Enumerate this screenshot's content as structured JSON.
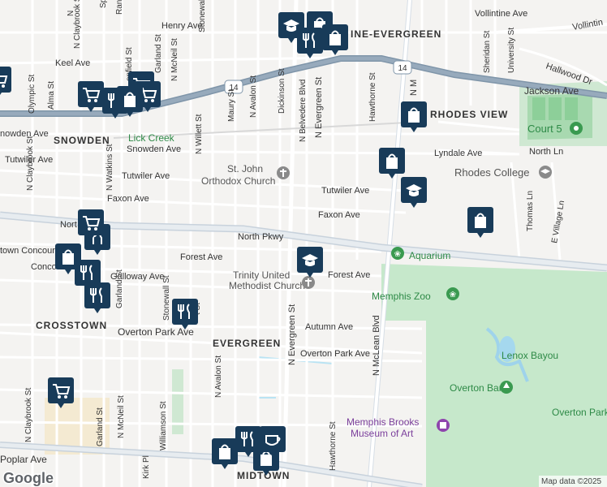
{
  "map": {
    "attribution": "Map data ©2025",
    "logo": "Google",
    "route_shield": "14",
    "areas": {
      "aquarium": "Aquarium",
      "memphis_zoo": "Memphis Zoo",
      "lenox_bayou": "Lenox Bayou",
      "overton_bark": "Overton Bark",
      "overton_park": "Overton Park",
      "brooks_museum": "Memphis Brooks Museum of Art",
      "brooks_line1": "Memphis Brooks",
      "brooks_line2": "Museum of Art",
      "court5": "Court 5",
      "rhodes_college": "Rhodes College",
      "st_john_line1": "St. John",
      "st_john_line2": "Orthodox Church",
      "trinity_line1": "Trinity United",
      "trinity_line2": "Methodist Church",
      "lick_creek": "Lick Creek"
    },
    "neighborhoods": {
      "snowden": "SNOWDEN",
      "crosstown": "CROSSTOWN",
      "evergreen": "EVERGREEN",
      "vollintine_evergreen": "INE-EVERGREEN",
      "rhodes_view": "RHODES VIEW",
      "midtown": "MIDTOWN",
      "town_concourse": "town Concours"
    },
    "streets": {
      "vollintine": "Vollintine Ave",
      "vollintin2": "Vollintin",
      "henry": "Henry Ave",
      "keel": "Keel Ave",
      "hallwood": "Hallwood Dr",
      "jackson": "Jackson Ave",
      "snowden_ave": "Snowden Ave",
      "snowden_ave2": "nowden Ave",
      "tutwiler": "Tutwiler Ave",
      "tutwiler2": "Tutwiler Ave",
      "tutwiler3": "Tutwiler Ave",
      "faxon": "Faxon Ave",
      "faxon2": "Faxon Ave",
      "lyndale": "Lyndale Ave",
      "north_ln": "North Ln",
      "north_pkwy": "North Pkwy",
      "north_pkwy_w": "Nort",
      "forest": "Forest Ave",
      "forest2": "Forest Ave",
      "galloway": "Galloway Ave",
      "autumn": "Autumn Ave",
      "overton_park_ave": "Overton Park Ave",
      "overton_park_ave2": "Overton Park Ave",
      "poplar": "Poplar Ave",
      "concord": "Conco",
      "n_evergreen": "N Evergreen St",
      "n_evergreen2": "N Evergreen St",
      "n_belvedere": "N Belvedere Blvd",
      "dickinson": "Dickinson St",
      "n_avalon": "N Avalon St",
      "n_avalon2": "N Avalon St",
      "maury": "Maury St",
      "n_willett": "N Willett St",
      "n_mcneil": "N McNeil St",
      "n_mcneil2": "N McNeil St",
      "garland": "Garland St",
      "garland2": "Garland St",
      "garland3": "Garland St",
      "n_watkins": "N Watkins St",
      "n_claybrook": "N Claybrook St",
      "n_claybrook2": "N Claybrook St",
      "n_claybrook3": "N Claybrook St",
      "alma": "Alma St",
      "olympic": "Olympic St",
      "stonewall": "Stonewall St",
      "stonewall2": "Stonewall St",
      "williamson": "Williamson St",
      "hawthorne": "Hawthorne St",
      "hawthorne2": "Hawthorne St",
      "n_mclean": "N McLean Blvd",
      "n_mclean_n": "N M",
      "sheridan": "Sheridan St",
      "university": "University St",
      "thomas": "Thomas Ln",
      "e_village": "E Village Ln",
      "springdale": "Spr",
      "ran": "Ran",
      "hood": "N",
      "kirk": "Kirk Pl",
      "evans": "t St",
      "enfield": "enfield St",
      "lynn_upper": "Lynn"
    }
  },
  "colors": {
    "pin": "#183b59",
    "road_major": "#8fa2b4",
    "park": "#c3e6c8",
    "water": "#a5d8ee",
    "route": "#7c92a7",
    "green_text": "#2e8a47"
  },
  "icons": {
    "shopping_cart": "shopping-cart-icon",
    "restaurant": "fork-knife-icon",
    "school": "graduation-cap-icon",
    "store": "shopping-bag-icon",
    "cafe": "coffee-cup-icon"
  }
}
